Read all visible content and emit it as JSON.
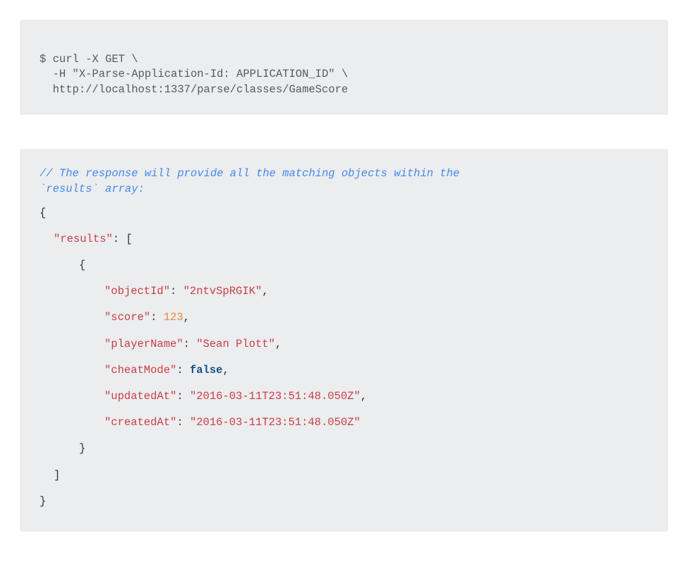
{
  "curl": {
    "line1": "$ curl -X GET \\",
    "line2": "  -H \"X-Parse-Application-Id: APPLICATION_ID\" \\",
    "line3": "  http://localhost:1337/parse/classes/GameScore"
  },
  "response": {
    "comment_line1": "// The response will provide all the matching objects within the",
    "comment_line2": "`results` array:",
    "tokens": {
      "results_key": "\"results\"",
      "objectId_key": "\"objectId\"",
      "objectId_val": "\"2ntvSpRGIK\"",
      "score_key": "\"score\"",
      "score_val": "123",
      "playerName_key": "\"playerName\"",
      "playerName_val": "\"Sean Plott\"",
      "cheatMode_key": "\"cheatMode\"",
      "cheatMode_val": "false",
      "updatedAt_key": "\"updatedAt\"",
      "updatedAt_val": "\"2016-03-11T23:51:48.050Z\"",
      "createdAt_key": "\"createdAt\"",
      "createdAt_val": "\"2016-03-11T23:51:48.050Z\""
    },
    "punct": {
      "open_brace": "{",
      "close_brace": "}",
      "open_bracket": "[",
      "close_bracket": "]",
      "colon_space": ": ",
      "comma": ","
    }
  }
}
